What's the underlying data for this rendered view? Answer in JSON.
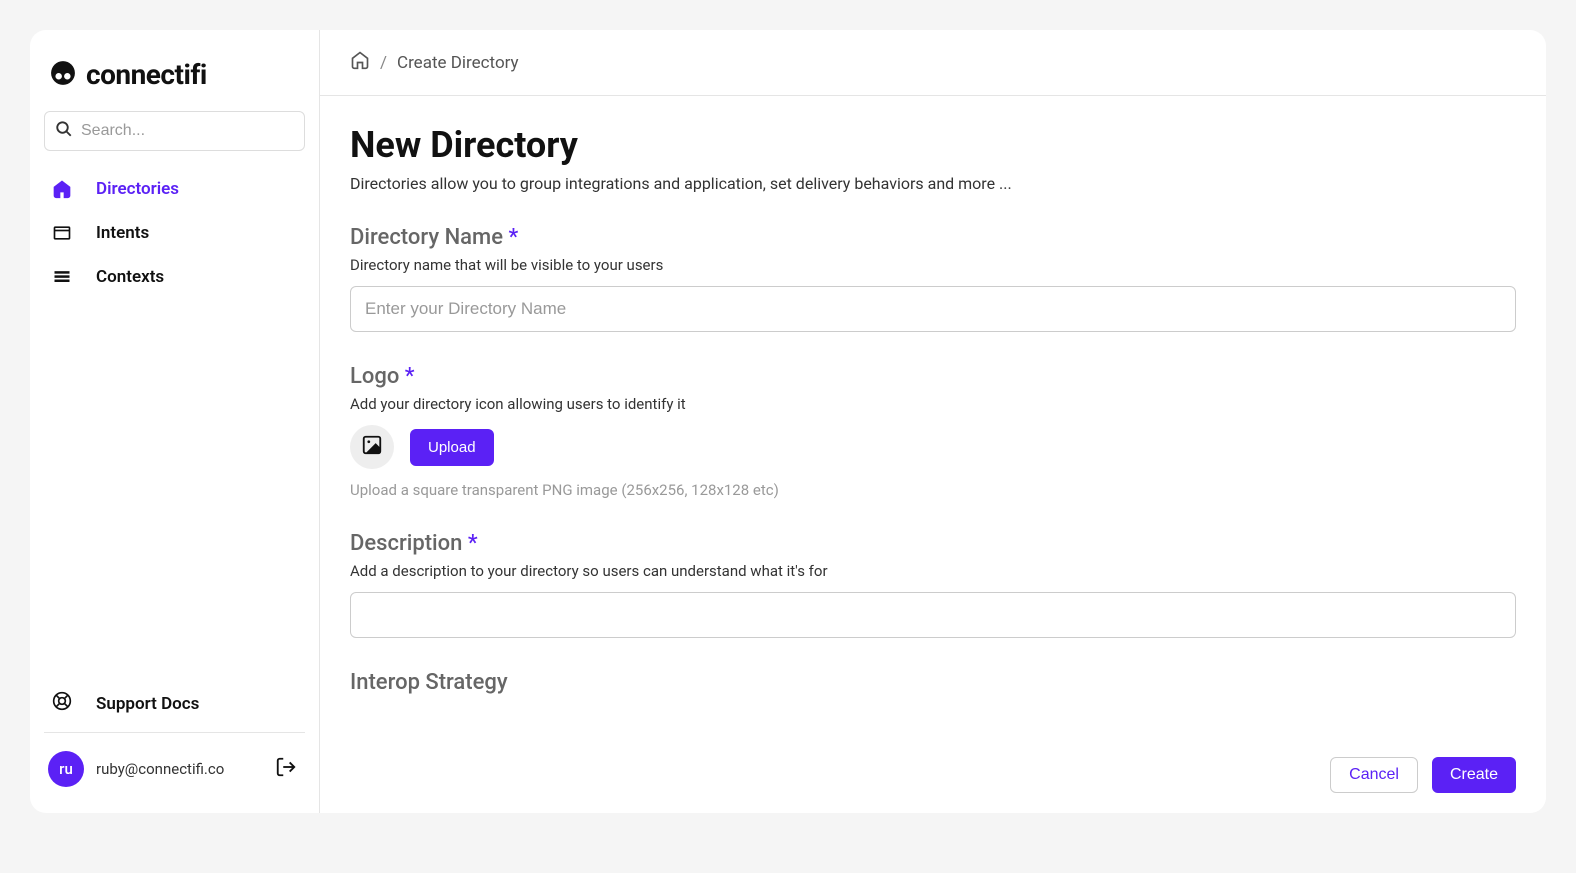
{
  "brand": {
    "name": "connectifi"
  },
  "search": {
    "placeholder": "Search..."
  },
  "sidebar": {
    "items": [
      {
        "label": "Directories",
        "active": true
      },
      {
        "label": "Intents",
        "active": false
      },
      {
        "label": "Contexts",
        "active": false
      }
    ],
    "support_label": "Support Docs"
  },
  "user": {
    "initials": "ru",
    "email": "ruby@connectifi.co"
  },
  "breadcrumb": {
    "separator": "/",
    "current": "Create Directory"
  },
  "page": {
    "title": "New Directory",
    "subtitle": "Directories allow you to group integrations and application, set delivery behaviors and more ..."
  },
  "form": {
    "name": {
      "label": "Directory Name",
      "required_mark": "*",
      "help": "Directory name that will be visible to your users",
      "placeholder": "Enter your Directory Name",
      "value": ""
    },
    "logo": {
      "label": "Logo",
      "required_mark": "*",
      "help": "Add your directory icon allowing users to identify it",
      "upload_label": "Upload",
      "hint": "Upload a square transparent PNG image (256x256, 128x128 etc)"
    },
    "description": {
      "label": "Description",
      "required_mark": "*",
      "help": "Add a description to your directory so users can understand what it's for",
      "value": ""
    },
    "interop": {
      "label": "Interop Strategy"
    }
  },
  "actions": {
    "cancel": "Cancel",
    "create": "Create"
  }
}
